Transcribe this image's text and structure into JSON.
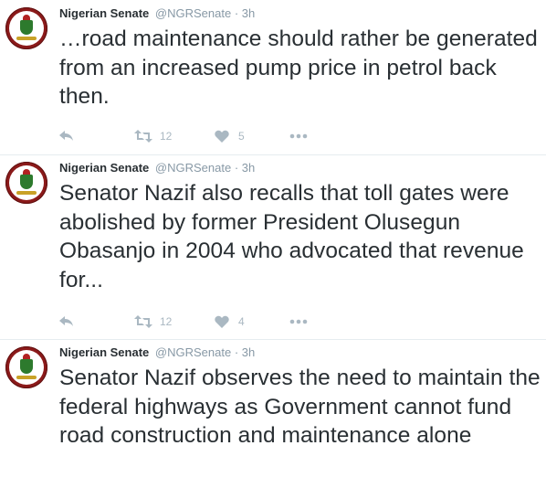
{
  "tweets": [
    {
      "author": "Nigerian Senate",
      "handle": "@NGRSenate",
      "separator": "·",
      "time": "3h",
      "text": "…road maintenance should rather be generated from an increased pump price in petrol back then.",
      "retweets": "12",
      "likes": "5"
    },
    {
      "author": "Nigerian Senate",
      "handle": "@NGRSenate",
      "separator": "·",
      "time": "3h",
      "text": "Senator Nazif also recalls that toll gates were abolished by former President Olusegun Obasanjo in 2004 who advocated that revenue for...",
      "retweets": "12",
      "likes": "4"
    },
    {
      "author": "Nigerian Senate",
      "handle": "@NGRSenate",
      "separator": "·",
      "time": "3h",
      "text": "Senator Nazif observes the need to maintain the federal highways as Government cannot fund road construction and maintenance alone",
      "retweets": "",
      "likes": ""
    }
  ],
  "icons": {
    "avatar": "nigerian-senate-seal",
    "reply": "reply-icon",
    "retweet": "retweet-icon",
    "like": "heart-icon",
    "more": "more-icon"
  },
  "colors": {
    "text": "#292f33",
    "meta": "#8899a6",
    "action": "#aab8c2",
    "divider": "#e6ecf0"
  }
}
